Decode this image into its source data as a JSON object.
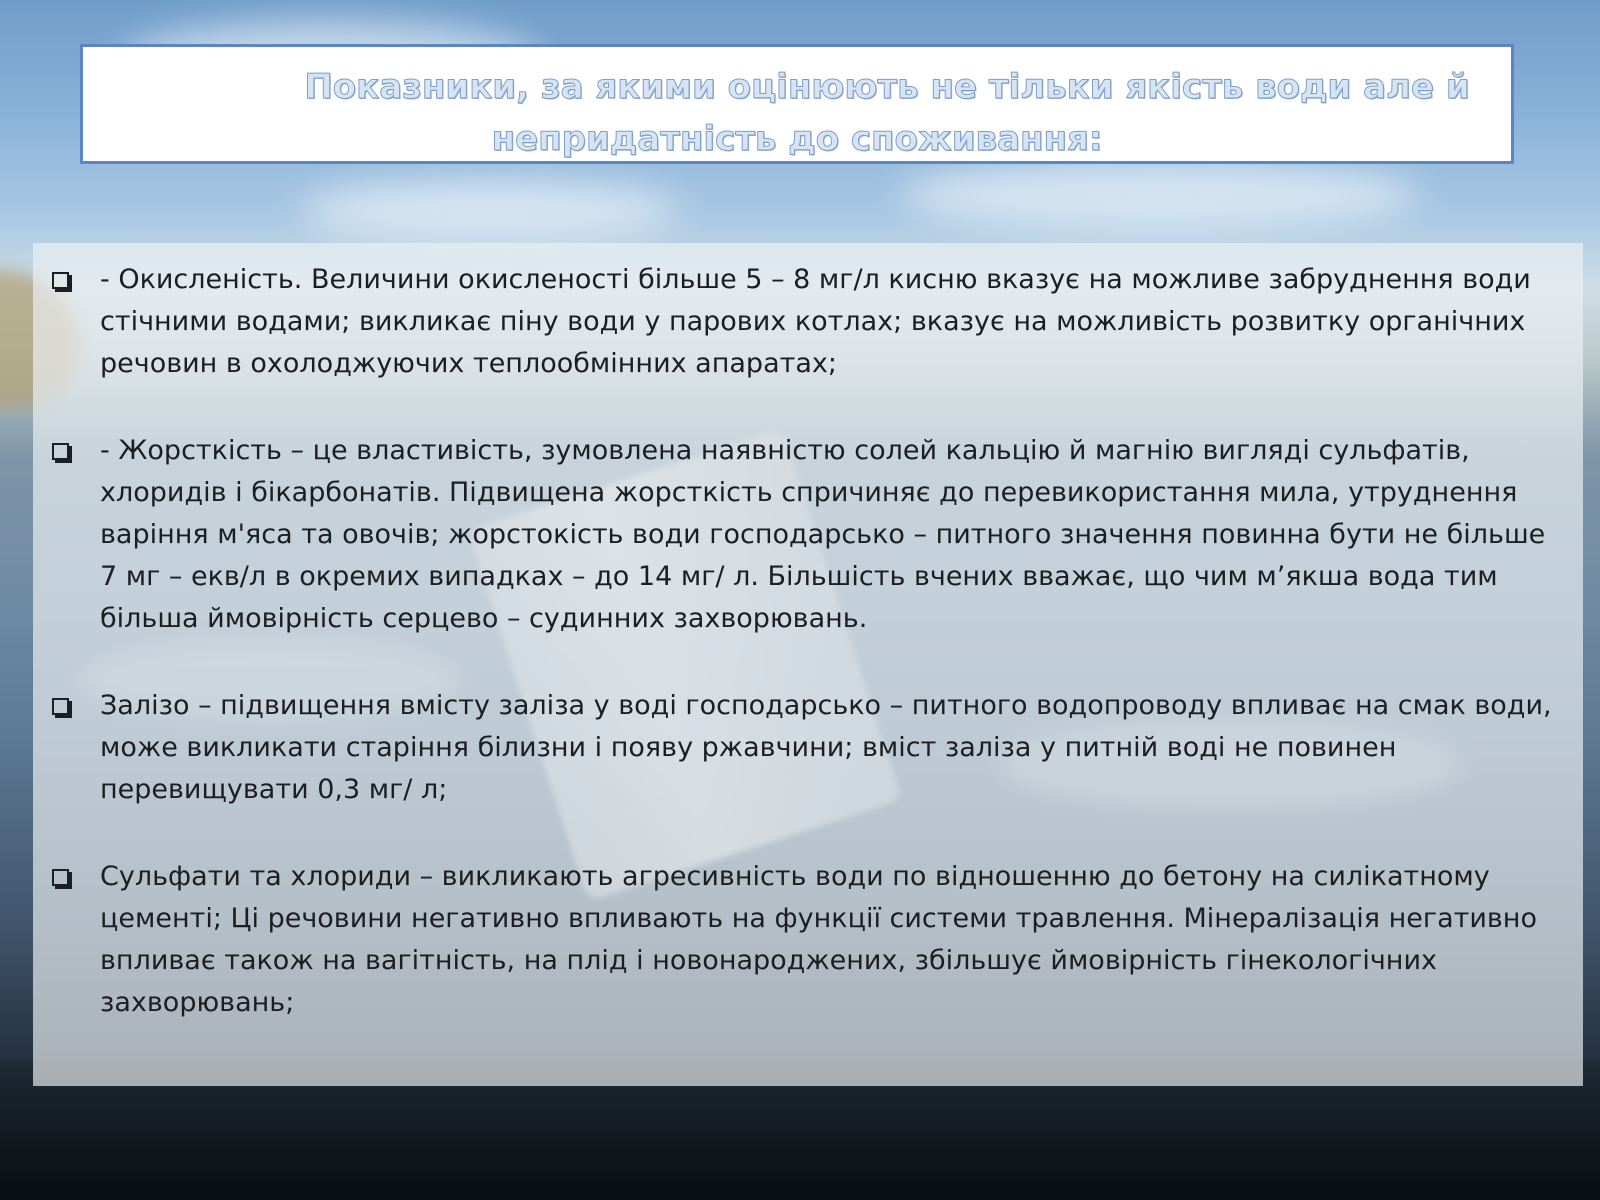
{
  "slide": {
    "title_line1": "Показники, за якими оцінюють не тільки якість води але й",
    "title_line2": "непридатність до споживання:",
    "items": [
      {
        "text": "- Окисленість. Величини окисленості більше 5 – 8 мг/л кисню вказує на можливе забруднення води стічними водами; викликає піну води у парових котлах; вказує на можливість розвитку органічних речовин в охолоджуючих теплообмінних апаратах;"
      },
      {
        "text": "- Жорсткість – це властивість, зумовлена наявністю солей кальцію й магнію вигляді сульфатів, хлоридів  і бікарбонатів. Підвищена жорсткість спричиняє до перевикористання мила, утруднення варіння м'яса та овочів; жорстокість води господарсько – питного значення повинна бути не більше 7 мг – екв/л в окремих випадках – до 14 мг/ л. Більшість вчених вважає, що чим м’якша вода тим більша ймовірність серцево – судинних захворювань."
      },
      {
        "text": "Залізо – підвищення вмісту заліза у воді господарсько – питного водопроводу впливає на  смак води, може викликати старіння білизни і появу ржавчини; вміст заліза у питній воді не повинен перевищувати 0,3 мг/ л;"
      },
      {
        "text": "Сульфати та хлориди – викликають агресивність води по відношенню до бетону на силікатному цементі; Ці речовини негативно впливають на функції системи травлення. Мінералізація негативно впливає також на вагітність, на плід і новонароджених, збільшує ймовірність гінекологічних захворювань;"
      }
    ]
  },
  "colors": {
    "title_border": "#5b86c3",
    "title_text": "#d7e4f2",
    "body_text": "#1b1f24"
  }
}
